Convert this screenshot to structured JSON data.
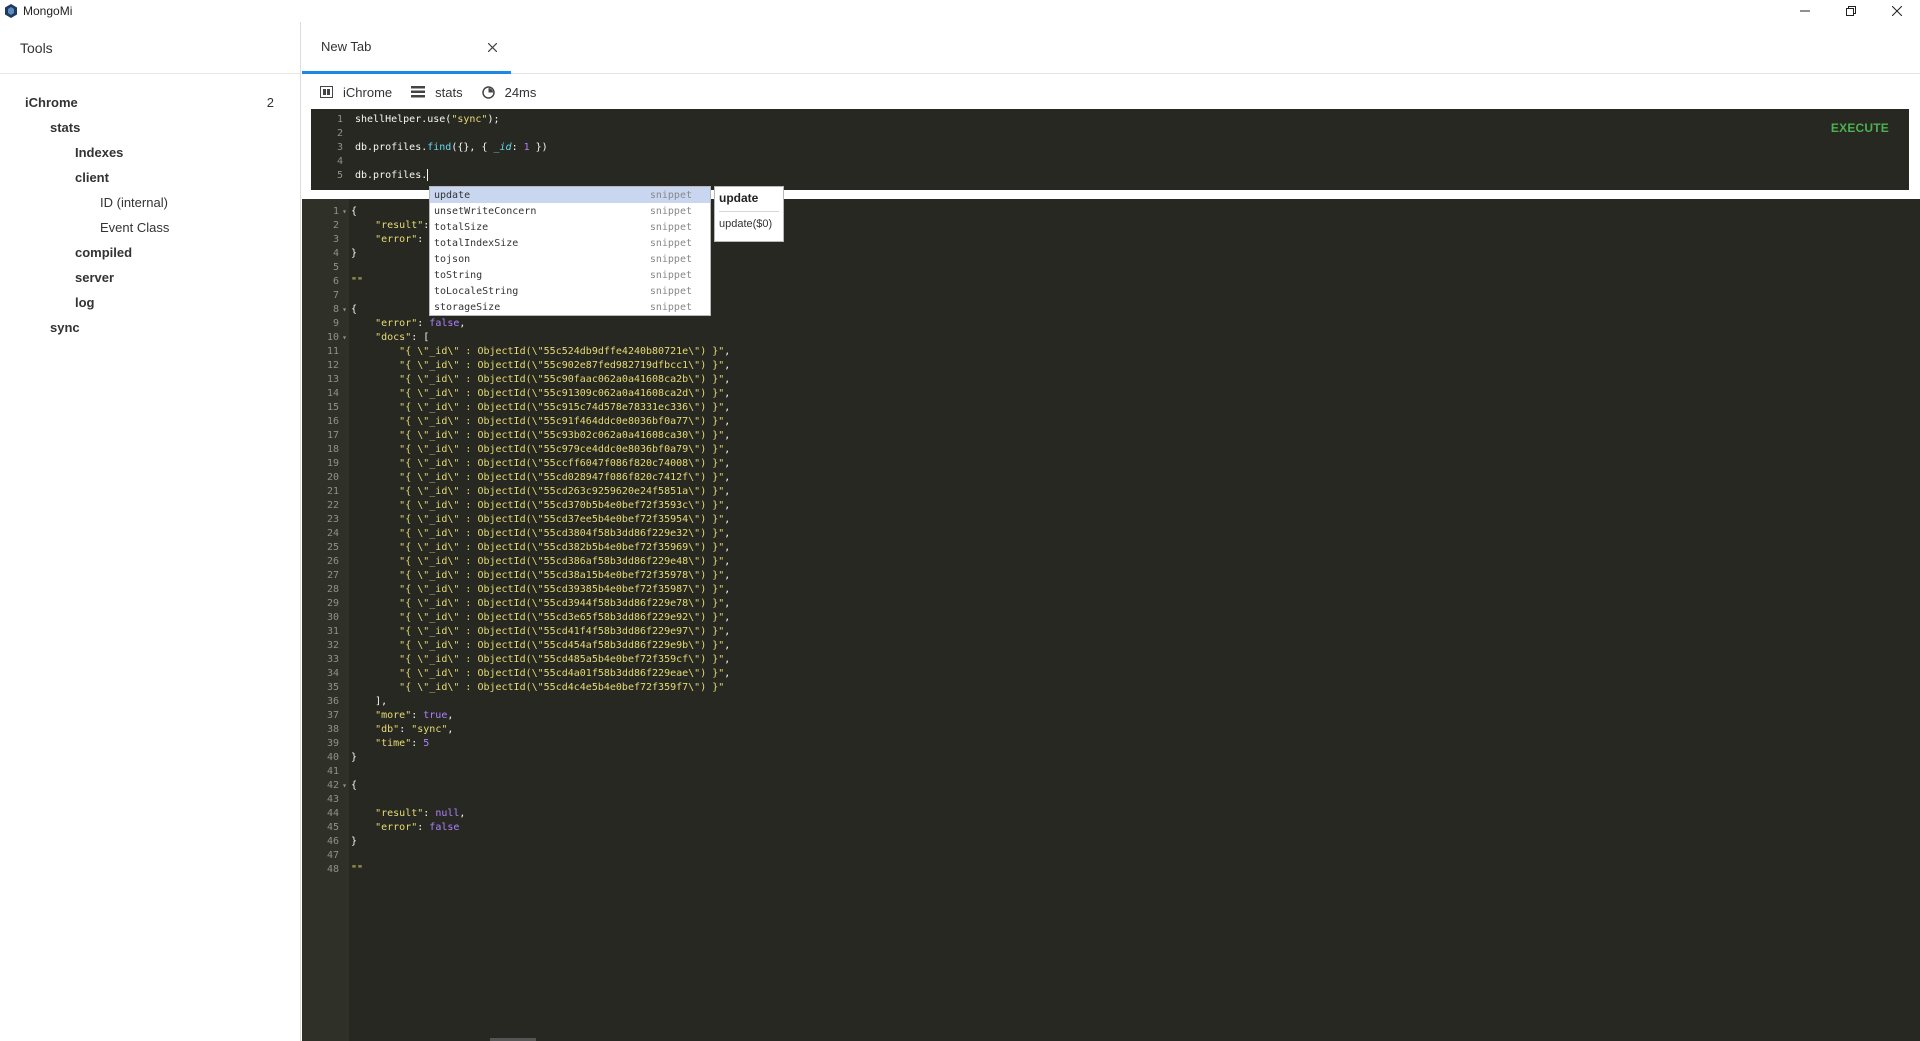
{
  "app": {
    "title": "MongoMi",
    "window_buttons": [
      "minimize-icon",
      "restore-icon",
      "close-icon"
    ]
  },
  "sidebar": {
    "header": "Tools",
    "tree": [
      {
        "label": "iChrome",
        "level": 0,
        "count": "2"
      },
      {
        "label": "stats",
        "level": 1
      },
      {
        "label": "Indexes",
        "level": 2
      },
      {
        "label": "client",
        "level": 2
      },
      {
        "label": "ID (internal)",
        "level": 3
      },
      {
        "label": "Event Class",
        "level": 3
      },
      {
        "label": "compiled",
        "level": 2
      },
      {
        "label": "server",
        "level": 2
      },
      {
        "label": "log",
        "level": 2
      },
      {
        "label": "sync",
        "level": 1
      }
    ]
  },
  "tabs": [
    {
      "label": "New Tab",
      "active": true
    }
  ],
  "infobar": {
    "database": "iChrome",
    "collection": "stats",
    "time": "24ms"
  },
  "editor": {
    "execute_label": "EXECUTE",
    "line_numbers": [
      "1",
      "2",
      "3",
      "4",
      "5"
    ]
  },
  "autocomplete": {
    "items": [
      {
        "name": "update",
        "meta": "snippet",
        "selected": true
      },
      {
        "name": "unsetWriteConcern",
        "meta": "snippet"
      },
      {
        "name": "totalSize",
        "meta": "snippet"
      },
      {
        "name": "totalIndexSize",
        "meta": "snippet"
      },
      {
        "name": "tojson",
        "meta": "snippet"
      },
      {
        "name": "toString",
        "meta": "snippet"
      },
      {
        "name": "toLocaleString",
        "meta": "snippet"
      },
      {
        "name": "storageSize",
        "meta": "snippet"
      }
    ],
    "doc_title": "update",
    "doc_signature": "update($0)"
  },
  "results": {
    "ids": [
      "55c524db9dffe4240b80721e",
      "55c902e87fed982719dfbcc1",
      "55c90faac062a0a41608ca2b",
      "55c91309c062a0a41608ca2d",
      "55c915c74d578e78331ec336",
      "55c91f464ddc0e8036bf0a77",
      "55c93b02c062a0a41608ca30",
      "55c979ce4ddc0e8036bf0a79",
      "55ccff6047f086f820c74008",
      "55cd028947f086f820c7412f",
      "55cd263c9259620e24f5851a",
      "55cd370b5b4e0bef72f3593c",
      "55cd37ee5b4e0bef72f35954",
      "55cd3804f58b3dd86f229e32",
      "55cd382b5b4e0bef72f35969",
      "55cd386af58b3dd86f229e48",
      "55cd38a15b4e0bef72f35978",
      "55cd39385b4e0bef72f35987",
      "55cd3944f58b3dd86f229e78",
      "55cd3e65f58b3dd86f229e92",
      "55cd41f4f58b3dd86f229e97",
      "55cd454af58b3dd86f229e9b",
      "55cd485a5b4e0bef72f359cf",
      "55cd4a01f58b3dd86f229eae",
      "55cd4c4e5b4e0bef72f359f7"
    ],
    "more": "true",
    "db": "\"sync\"",
    "time": "5"
  }
}
